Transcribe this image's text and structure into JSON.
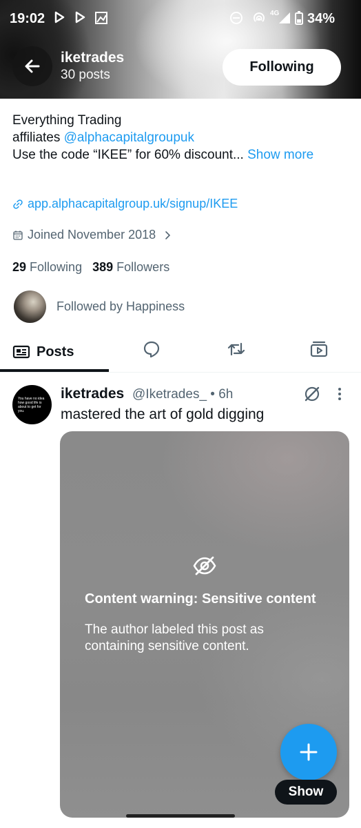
{
  "status_bar": {
    "time": "19:02",
    "network": "4G",
    "battery": "34%"
  },
  "header": {
    "name": "iketrades",
    "posts_count": "30 posts",
    "follow_button": "Following"
  },
  "bio": {
    "line1": "Everything Trading",
    "line2_prefix": "affiliates ",
    "line2_mention": "@alphacapitalgroupuk",
    "line3": "Use the code “IKEE” for 60% discount...",
    "show_more": " Show more"
  },
  "profile": {
    "website": "app.alphacapitalgroup.uk/signup/IKEE",
    "joined": "Joined November 2018",
    "following_count": "29",
    "following_label": "Following",
    "followers_count": "389",
    "followers_label": "Followers",
    "followed_by": "Followed by Happiness"
  },
  "tabs": {
    "posts": "Posts"
  },
  "tweet": {
    "name": "iketrades",
    "handle_time": "@Iketrades_ • 6h",
    "text": "mastered the art of gold digging",
    "avatar_text": "You have no idea how good life is about to get for you.",
    "content_warning_title": "Content warning: Sensitive content",
    "content_warning_desc": "The author labeled this post as containing sensitive content.",
    "show_button": "Show"
  },
  "colors": {
    "accent": "#1d9bf0",
    "text_primary": "#0f1419",
    "text_secondary": "#536471"
  }
}
